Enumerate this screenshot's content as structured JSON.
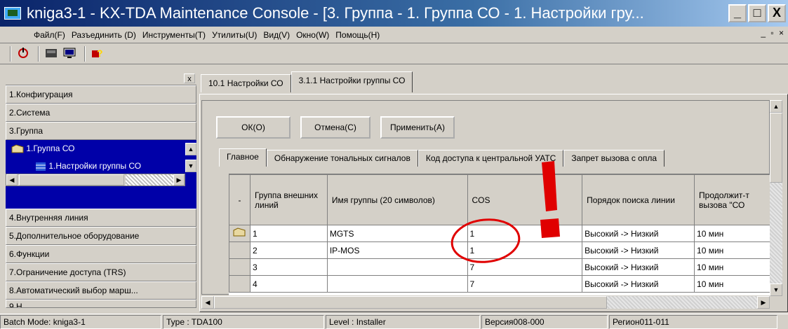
{
  "window": {
    "title": "kniga3-1 - KX-TDA Maintenance Console - [3. Группа - 1. Группа СО - 1. Настройки гру...",
    "min_label": "_",
    "max_label": "□",
    "close_label": "X"
  },
  "menu": {
    "items": [
      "Файл(F)",
      "Разъединить (D)",
      "Инструменты(T)",
      "Утилиты(U)",
      "Вид(V)",
      "Окно(W)",
      "Помощь(H)"
    ],
    "mdi_controls": "_ ▫ ×"
  },
  "toolbar": {
    "icons": [
      "connect-icon",
      "database-icon",
      "monitor-icon",
      "help-icon"
    ]
  },
  "left_panel": {
    "close_label": "x",
    "items": [
      "1.Конфигурация",
      "2.Система",
      "3.Группа"
    ],
    "selected_group": "1.Группа СО",
    "selected_sub": "1.Настройки группы СО",
    "items_after": [
      "4.Внутренняя линия",
      "5.Дополнительное оборудование",
      "6.Функции",
      "7.Ограничение доступа (TRS)",
      "8.Автоматический выбор марш...",
      "9.Н..."
    ]
  },
  "top_tabs": [
    "10.1 Настройки СО",
    "3.1.1 Настройки группы СО"
  ],
  "buttons": {
    "ok": "ОК(О)",
    "cancel": "Отмена(С)",
    "apply": "Применить(А)"
  },
  "sub_tabs": [
    "Главное",
    "Обнаружение тональных сигналов",
    "Код доступа к центральной УАТС",
    "Запрет вызова с опла"
  ],
  "grid": {
    "columns": [
      "-",
      "Группа внешних линий",
      "Имя группы (20 символов)",
      "COS",
      "Порядок поиска линии",
      "Продолжит-т вызова \"СО"
    ],
    "rows": [
      {
        "marker": "pointer",
        "group": "1",
        "name": "MGTS",
        "cos": "1",
        "order": "Высокий -> Низкий",
        "duration": "10 мин"
      },
      {
        "marker": "",
        "group": "2",
        "name": "IP-MOS",
        "cos": "1",
        "order": "Высокий -> Низкий",
        "duration": "10 мин"
      },
      {
        "marker": "",
        "group": "3",
        "name": "",
        "cos": "7",
        "order": "Высокий -> Низкий",
        "duration": "10 мин"
      },
      {
        "marker": "",
        "group": "4",
        "name": "",
        "cos": "7",
        "order": "Высокий -> Низкий",
        "duration": "10 мин"
      }
    ]
  },
  "status": {
    "batch": "Batch Mode: kniga3-1",
    "type": "Type : TDA100",
    "level": "Level : Installer",
    "version": "Версия008-000",
    "region": "Регион011-011"
  },
  "colors": {
    "title_start": "#0a246a",
    "selection": "#0000a8",
    "annotation": "#e00000"
  }
}
